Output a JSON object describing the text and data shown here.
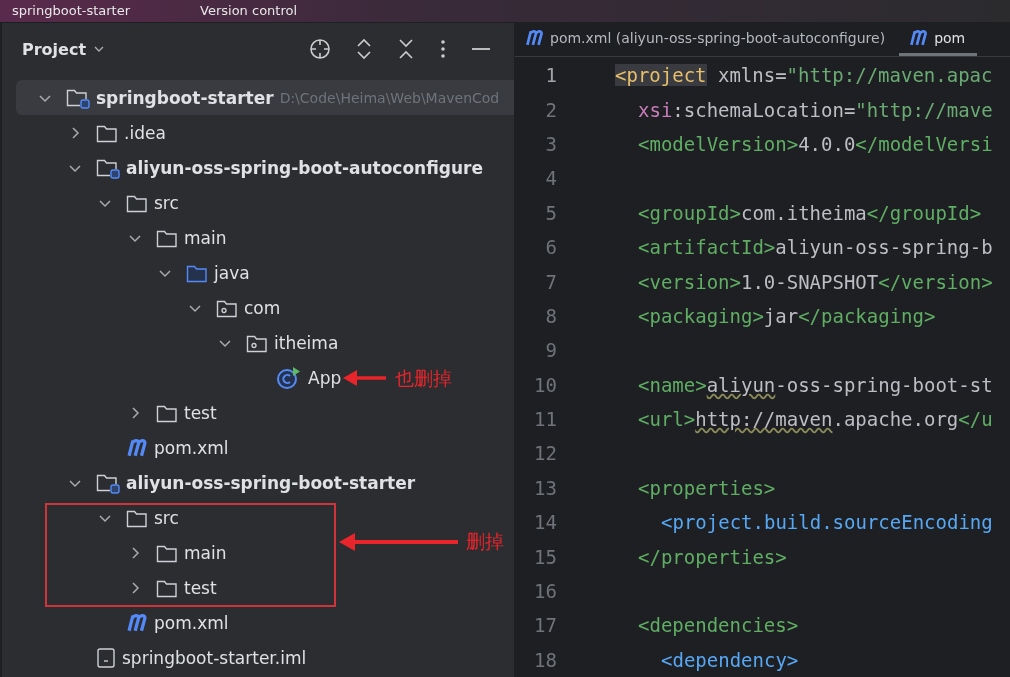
{
  "title_bar": {
    "project": "springboot-starter",
    "vcs": "Version control"
  },
  "project_panel": {
    "title": "Project"
  },
  "tree": [
    {
      "kind": "module",
      "label": "springboot-starter",
      "note": "D:\\Code\\Heima\\Web\\MavenCod",
      "selected": true,
      "expanded": true,
      "children": [
        {
          "kind": "folder",
          "label": ".idea",
          "selected": false,
          "expanded": false
        },
        {
          "kind": "module",
          "label": "aliyun-oss-spring-boot-autoconfigure",
          "selected": false,
          "expanded": true,
          "children": [
            {
              "kind": "folder",
              "label": "src",
              "selected": false,
              "expanded": true,
              "children": [
                {
                  "kind": "folder",
                  "label": "main",
                  "selected": false,
                  "expanded": true,
                  "children": [
                    {
                      "kind": "source",
                      "label": "java",
                      "selected": false,
                      "expanded": true,
                      "children": [
                        {
                          "kind": "package",
                          "label": "com",
                          "selected": false,
                          "expanded": true,
                          "children": [
                            {
                              "kind": "package",
                              "label": "itheima",
                              "selected": false,
                              "expanded": true,
                              "children": [
                                {
                                  "kind": "class",
                                  "label": "App",
                                  "selected": false
                                }
                              ]
                            }
                          ]
                        }
                      ]
                    }
                  ]
                },
                {
                  "kind": "folder",
                  "label": "test",
                  "selected": false,
                  "expanded": false
                }
              ]
            },
            {
              "kind": "maven",
              "label": "pom.xml",
              "selected": false
            }
          ]
        },
        {
          "kind": "module",
          "label": "aliyun-oss-spring-boot-starter",
          "selected": false,
          "expanded": true,
          "children": [
            {
              "kind": "folder",
              "label": "src",
              "selected": false,
              "expanded": true,
              "children": [
                {
                  "kind": "folder",
                  "label": "main",
                  "selected": false,
                  "expanded": false
                },
                {
                  "kind": "folder",
                  "label": "test",
                  "selected": false,
                  "expanded": false
                }
              ]
            },
            {
              "kind": "maven",
              "label": "pom.xml",
              "selected": false
            }
          ]
        },
        {
          "kind": "iml",
          "label": "springboot-starter.iml",
          "selected": false
        }
      ]
    }
  ],
  "annotations": [
    {
      "text": "也删掉"
    },
    {
      "text": "删掉"
    }
  ],
  "tabs": [
    {
      "label": "pom.xml (aliyun-oss-spring-boot-autoconfigure)",
      "selected": false
    },
    {
      "label": "pom",
      "selected": true
    }
  ],
  "code_lines": [
    {
      "number": "1",
      "kind": "top",
      "tokens": [
        {
          "kind": "tag-yellow",
          "text": "<project"
        },
        {
          "kind": "text",
          "text": " xmlns="
        },
        {
          "kind": "string",
          "text": "\"http://maven.apac"
        }
      ]
    },
    {
      "number": "2",
      "kind": "inner",
      "tokens": [
        {
          "kind": "ns",
          "text": "xsi"
        },
        {
          "kind": "text",
          "text": ":schemaLocation="
        },
        {
          "kind": "string",
          "text": "\"http://mave"
        }
      ]
    },
    {
      "number": "3",
      "kind": "inner",
      "tokens": [
        {
          "kind": "tag",
          "text": "<modelVersion>"
        },
        {
          "kind": "text",
          "text": "4.0.0"
        },
        {
          "kind": "tag",
          "text": "</modelVersi"
        }
      ]
    },
    {
      "number": "4"
    },
    {
      "number": "5",
      "kind": "inner",
      "tokens": [
        {
          "kind": "tag",
          "text": "<groupId>"
        },
        {
          "kind": "text",
          "text": "com.itheima"
        },
        {
          "kind": "tag",
          "text": "</groupId>"
        }
      ]
    },
    {
      "number": "6",
      "kind": "inner",
      "tokens": [
        {
          "kind": "tag",
          "text": "<artifactId>"
        },
        {
          "kind": "text",
          "text": "aliyun-oss-spring-b"
        }
      ]
    },
    {
      "number": "7",
      "kind": "inner",
      "tokens": [
        {
          "kind": "tag",
          "text": "<version>"
        },
        {
          "kind": "text",
          "text": "1.0-SNAPSHOT"
        },
        {
          "kind": "tag",
          "text": "</version>"
        }
      ]
    },
    {
      "number": "8",
      "kind": "inner",
      "tokens": [
        {
          "kind": "tag",
          "text": "<packaging>"
        },
        {
          "kind": "text",
          "text": "jar"
        },
        {
          "kind": "tag",
          "text": "</packaging>"
        }
      ]
    },
    {
      "number": "9"
    },
    {
      "number": "10",
      "kind": "inner",
      "tokens": [
        {
          "kind": "tag",
          "text": "<name>"
        },
        {
          "kind": "typo",
          "text": "aliyun"
        },
        {
          "kind": "text",
          "text": "-oss-spring-boot-st"
        }
      ]
    },
    {
      "number": "11",
      "kind": "inner",
      "tokens": [
        {
          "kind": "tag",
          "text": "<url>"
        },
        {
          "kind": "typo",
          "text": "http://maven"
        },
        {
          "kind": "text",
          "text": ".apache.org"
        },
        {
          "kind": "tag",
          "text": "</u"
        }
      ]
    },
    {
      "number": "12"
    },
    {
      "number": "13",
      "kind": "inner",
      "tokens": [
        {
          "kind": "tag",
          "text": "<properties>"
        }
      ]
    },
    {
      "number": "14",
      "kind": "deep",
      "tokens": [
        {
          "kind": "tag-blue",
          "text": "<project.build.sourceEncoding"
        }
      ]
    },
    {
      "number": "15",
      "kind": "inner",
      "tokens": [
        {
          "kind": "tag",
          "text": "</properties>"
        }
      ]
    },
    {
      "number": "16"
    },
    {
      "number": "17",
      "kind": "inner",
      "tokens": [
        {
          "kind": "tag",
          "text": "<dependencies>"
        }
      ]
    },
    {
      "number": "18",
      "kind": "deep",
      "tokens": [
        {
          "kind": "tag-blue",
          "text": "<dependency>"
        }
      ]
    }
  ]
}
